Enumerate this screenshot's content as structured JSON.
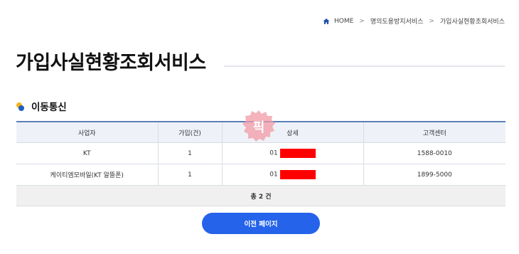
{
  "breadcrumb": {
    "home": "HOME",
    "items": [
      "명의도용방지서비스",
      "가입사실현황조회서비스"
    ]
  },
  "page": {
    "title": "가입사실현황조회서비스"
  },
  "section": {
    "title": "이동통신"
  },
  "table": {
    "headers": [
      "사업자",
      "가입(건)",
      "상세",
      "고객센터"
    ],
    "rows": [
      {
        "carrier": "KT",
        "count": "1",
        "detail": "01",
        "service_center": "1588-0010"
      },
      {
        "carrier": "케이티엠모바일(KT 알뜰폰)",
        "count": "1",
        "detail": "01",
        "service_center": "1899-5000"
      }
    ],
    "total": "총 2 건"
  },
  "stamp": {
    "text": "픽",
    "color": "#f29aa6"
  },
  "buttons": {
    "prev": "이전 페이지"
  },
  "colors": {
    "accent": "#2563eb",
    "header_border": "#5b7fb6",
    "redaction": "#ff0000"
  }
}
